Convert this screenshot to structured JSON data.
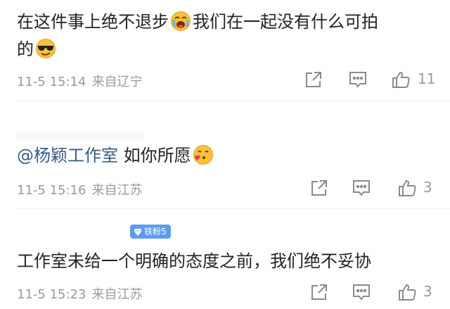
{
  "comments": [
    {
      "text_line1_a": "在这件事上绝不退步",
      "text_line1_b": "我们在一起没有什么可拍",
      "text_line2": "的",
      "emoji1": "crying-loudly-emoji",
      "emoji2": "cool-sunglasses-emoji",
      "time": "11-5 15:14",
      "source": "来自辽宁",
      "likes": "11",
      "icons": [
        "share-icon",
        "comment-icon",
        "like-icon"
      ]
    },
    {
      "mention": "@杨颖工作室",
      "text": "如你所愿",
      "emoji": "blowing-kiss-emoji",
      "time": "11-5 15:16",
      "source": "来自江苏",
      "likes": "3",
      "icons": [
        "share-icon",
        "comment-icon",
        "like-icon"
      ]
    },
    {
      "badge": "铁粉5",
      "badge_icon": "diamond-icon",
      "text": "工作室未给一个明确的态度之前，我们绝不妥协",
      "time": "11-5 15:23",
      "source": "来自江苏",
      "likes": "3",
      "icons": [
        "share-icon",
        "comment-icon",
        "like-icon"
      ]
    }
  ],
  "colors": {
    "mention": "#3a5a86",
    "meta": "#9a9a9a",
    "badge": "#5d9bf0",
    "emoji_face": "#f7c23c"
  }
}
